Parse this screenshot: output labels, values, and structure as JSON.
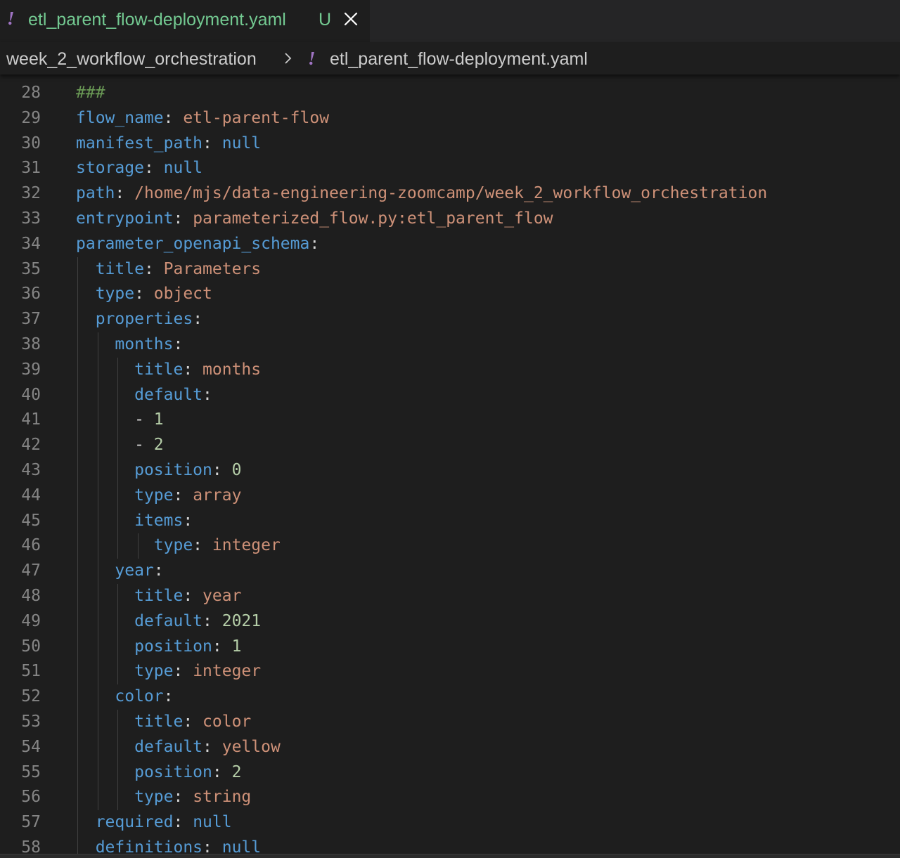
{
  "tab": {
    "filename": "etl_parent_flow-deployment.yaml",
    "status": "U",
    "icon": "yaml-exclamation-icon"
  },
  "breadcrumb": {
    "folder": "week_2_workflow_orchestration",
    "file": "etl_parent_flow-deployment.yaml"
  },
  "editor": {
    "lines": [
      {
        "n": "28",
        "indent": 0,
        "parts": [
          {
            "t": "###",
            "c": "c"
          }
        ]
      },
      {
        "n": "29",
        "indent": 0,
        "parts": [
          {
            "t": "flow_name",
            "c": "k"
          },
          {
            "t": ": ",
            "c": "p"
          },
          {
            "t": "etl-parent-flow",
            "c": "s"
          }
        ]
      },
      {
        "n": "30",
        "indent": 0,
        "parts": [
          {
            "t": "manifest_path",
            "c": "k"
          },
          {
            "t": ": ",
            "c": "p"
          },
          {
            "t": "null",
            "c": "k"
          }
        ]
      },
      {
        "n": "31",
        "indent": 0,
        "parts": [
          {
            "t": "storage",
            "c": "k"
          },
          {
            "t": ": ",
            "c": "p"
          },
          {
            "t": "null",
            "c": "k"
          }
        ]
      },
      {
        "n": "32",
        "indent": 0,
        "parts": [
          {
            "t": "path",
            "c": "k"
          },
          {
            "t": ": ",
            "c": "p"
          },
          {
            "t": "/home/mjs/data-engineering-zoomcamp/week_2_workflow_orchestration",
            "c": "s"
          }
        ]
      },
      {
        "n": "33",
        "indent": 0,
        "parts": [
          {
            "t": "entrypoint",
            "c": "k"
          },
          {
            "t": ": ",
            "c": "p"
          },
          {
            "t": "parameterized_flow.py:etl_parent_flow",
            "c": "s"
          }
        ]
      },
      {
        "n": "34",
        "indent": 0,
        "parts": [
          {
            "t": "parameter_openapi_schema",
            "c": "k"
          },
          {
            "t": ":",
            "c": "p"
          }
        ]
      },
      {
        "n": "35",
        "indent": 1,
        "parts": [
          {
            "t": "title",
            "c": "k"
          },
          {
            "t": ": ",
            "c": "p"
          },
          {
            "t": "Parameters",
            "c": "s"
          }
        ]
      },
      {
        "n": "36",
        "indent": 1,
        "parts": [
          {
            "t": "type",
            "c": "k"
          },
          {
            "t": ": ",
            "c": "p"
          },
          {
            "t": "object",
            "c": "s"
          }
        ]
      },
      {
        "n": "37",
        "indent": 1,
        "parts": [
          {
            "t": "properties",
            "c": "k"
          },
          {
            "t": ":",
            "c": "p"
          }
        ]
      },
      {
        "n": "38",
        "indent": 2,
        "parts": [
          {
            "t": "months",
            "c": "k"
          },
          {
            "t": ":",
            "c": "p"
          }
        ]
      },
      {
        "n": "39",
        "indent": 3,
        "parts": [
          {
            "t": "title",
            "c": "k"
          },
          {
            "t": ": ",
            "c": "p"
          },
          {
            "t": "months",
            "c": "s"
          }
        ]
      },
      {
        "n": "40",
        "indent": 3,
        "parts": [
          {
            "t": "default",
            "c": "k"
          },
          {
            "t": ":",
            "c": "p"
          }
        ]
      },
      {
        "n": "41",
        "indent": 3,
        "parts": [
          {
            "t": "- ",
            "c": "p"
          },
          {
            "t": "1",
            "c": "n"
          }
        ]
      },
      {
        "n": "42",
        "indent": 3,
        "parts": [
          {
            "t": "- ",
            "c": "p"
          },
          {
            "t": "2",
            "c": "n"
          }
        ]
      },
      {
        "n": "43",
        "indent": 3,
        "parts": [
          {
            "t": "position",
            "c": "k"
          },
          {
            "t": ": ",
            "c": "p"
          },
          {
            "t": "0",
            "c": "n"
          }
        ]
      },
      {
        "n": "44",
        "indent": 3,
        "parts": [
          {
            "t": "type",
            "c": "k"
          },
          {
            "t": ": ",
            "c": "p"
          },
          {
            "t": "array",
            "c": "s"
          }
        ]
      },
      {
        "n": "45",
        "indent": 3,
        "parts": [
          {
            "t": "items",
            "c": "k"
          },
          {
            "t": ":",
            "c": "p"
          }
        ]
      },
      {
        "n": "46",
        "indent": 4,
        "parts": [
          {
            "t": "type",
            "c": "k"
          },
          {
            "t": ": ",
            "c": "p"
          },
          {
            "t": "integer",
            "c": "s"
          }
        ]
      },
      {
        "n": "47",
        "indent": 2,
        "parts": [
          {
            "t": "year",
            "c": "k"
          },
          {
            "t": ":",
            "c": "p"
          }
        ]
      },
      {
        "n": "48",
        "indent": 3,
        "parts": [
          {
            "t": "title",
            "c": "k"
          },
          {
            "t": ": ",
            "c": "p"
          },
          {
            "t": "year",
            "c": "s"
          }
        ]
      },
      {
        "n": "49",
        "indent": 3,
        "parts": [
          {
            "t": "default",
            "c": "k"
          },
          {
            "t": ": ",
            "c": "p"
          },
          {
            "t": "2021",
            "c": "n"
          }
        ]
      },
      {
        "n": "50",
        "indent": 3,
        "parts": [
          {
            "t": "position",
            "c": "k"
          },
          {
            "t": ": ",
            "c": "p"
          },
          {
            "t": "1",
            "c": "n"
          }
        ]
      },
      {
        "n": "51",
        "indent": 3,
        "parts": [
          {
            "t": "type",
            "c": "k"
          },
          {
            "t": ": ",
            "c": "p"
          },
          {
            "t": "integer",
            "c": "s"
          }
        ]
      },
      {
        "n": "52",
        "indent": 2,
        "parts": [
          {
            "t": "color",
            "c": "k"
          },
          {
            "t": ":",
            "c": "p"
          }
        ]
      },
      {
        "n": "53",
        "indent": 3,
        "parts": [
          {
            "t": "title",
            "c": "k"
          },
          {
            "t": ": ",
            "c": "p"
          },
          {
            "t": "color",
            "c": "s"
          }
        ]
      },
      {
        "n": "54",
        "indent": 3,
        "parts": [
          {
            "t": "default",
            "c": "k"
          },
          {
            "t": ": ",
            "c": "p"
          },
          {
            "t": "yellow",
            "c": "s"
          }
        ]
      },
      {
        "n": "55",
        "indent": 3,
        "parts": [
          {
            "t": "position",
            "c": "k"
          },
          {
            "t": ": ",
            "c": "p"
          },
          {
            "t": "2",
            "c": "n"
          }
        ]
      },
      {
        "n": "56",
        "indent": 3,
        "parts": [
          {
            "t": "type",
            "c": "k"
          },
          {
            "t": ": ",
            "c": "p"
          },
          {
            "t": "string",
            "c": "s"
          }
        ]
      },
      {
        "n": "57",
        "indent": 1,
        "parts": [
          {
            "t": "required",
            "c": "k"
          },
          {
            "t": ": ",
            "c": "p"
          },
          {
            "t": "null",
            "c": "k"
          }
        ]
      },
      {
        "n": "58",
        "indent": 1,
        "parts": [
          {
            "t": "definitions",
            "c": "k"
          },
          {
            "t": ": ",
            "c": "p"
          },
          {
            "t": "null",
            "c": "k"
          }
        ]
      }
    ]
  },
  "colors": {
    "key": "#569cd6",
    "string": "#ce9178",
    "number": "#b5cea8",
    "comment": "#6a9955",
    "tab_text_untracked": "#73c991",
    "yaml_icon": "#a074c4",
    "background": "#1e1e1e"
  }
}
